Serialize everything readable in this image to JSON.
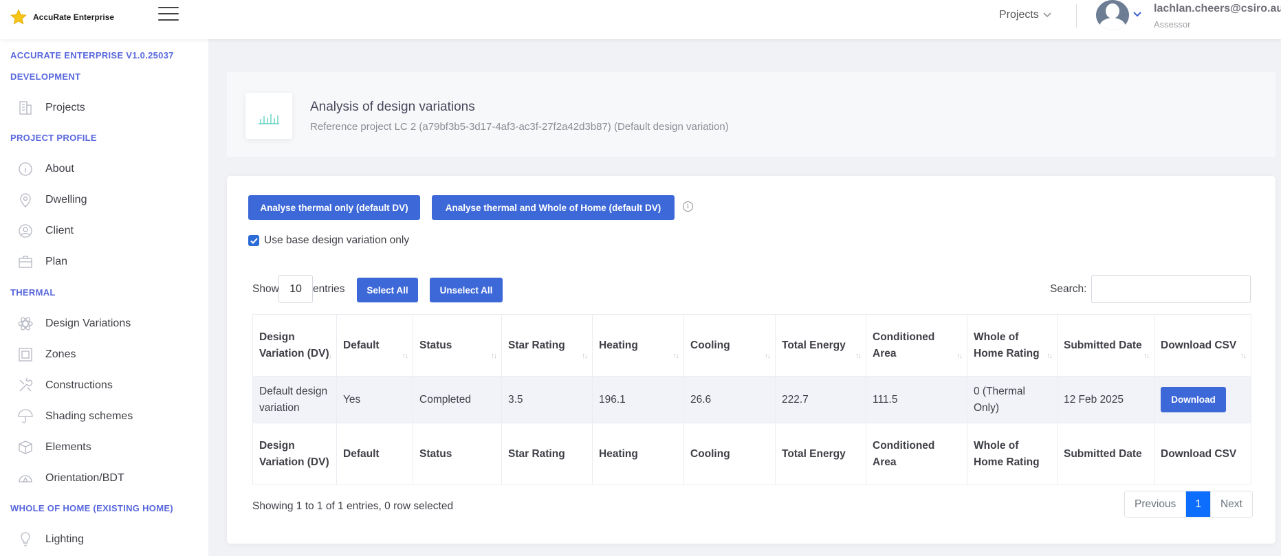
{
  "app": {
    "name": "AccuRate Enterprise"
  },
  "header": {
    "projects_label": "Projects",
    "user_email": "lachlan.cheers@csiro.au",
    "user_role": "Assessor"
  },
  "sidebar": {
    "version_title": "ACCURATE ENTERPRISE V1.0.25037",
    "version_subtitle": "DEVELOPMENT",
    "projects_label": "Projects",
    "sections": [
      {
        "title": "PROJECT PROFILE",
        "items": [
          "About",
          "Dwelling",
          "Client",
          "Plan"
        ]
      },
      {
        "title": "THERMAL",
        "items": [
          "Design Variations",
          "Zones",
          "Constructions",
          "Shading schemes",
          "Elements",
          "Orientation/BDT"
        ]
      },
      {
        "title": "WHOLE OF HOME (EXISTING HOME)",
        "items": [
          "Lighting"
        ]
      }
    ]
  },
  "subheader": {
    "title": "Analysis of design variations",
    "description": "Reference project LC 2 (a79bf3b5-3d17-4af3-ac3f-27f2a42d3b87) (Default design variation)"
  },
  "actions": {
    "analyse_thermal": "Analyse thermal only (default DV)",
    "analyse_whole": "Analyse thermal and Whole of Home (default DV)",
    "use_base_label": "Use base design variation only",
    "use_base_checked": true
  },
  "table_controls": {
    "show_label": "Show",
    "entries_value": "10",
    "entries_label": "entries",
    "select_all": "Select All",
    "unselect_all": "Unselect All",
    "search_label": "Search:"
  },
  "table": {
    "headers": [
      "Design Variation (DV)",
      "Default",
      "Status",
      "Star Rating",
      "Heating",
      "Cooling",
      "Total Energy",
      "Conditioned Area",
      "Whole of Home Rating",
      "Submitted Date",
      "Download CSV"
    ],
    "rows": [
      [
        "Default design variation",
        "Yes",
        "Completed",
        "3.5",
        "196.1",
        "26.6",
        "222.7",
        "111.5",
        "0 (Thermal Only)",
        "12 Feb 2025",
        "Download"
      ]
    ]
  },
  "footer": {
    "info": "Showing 1 to 1 of 1 entries, 0 row selected",
    "previous": "Previous",
    "page": "1",
    "next": "Next"
  }
}
